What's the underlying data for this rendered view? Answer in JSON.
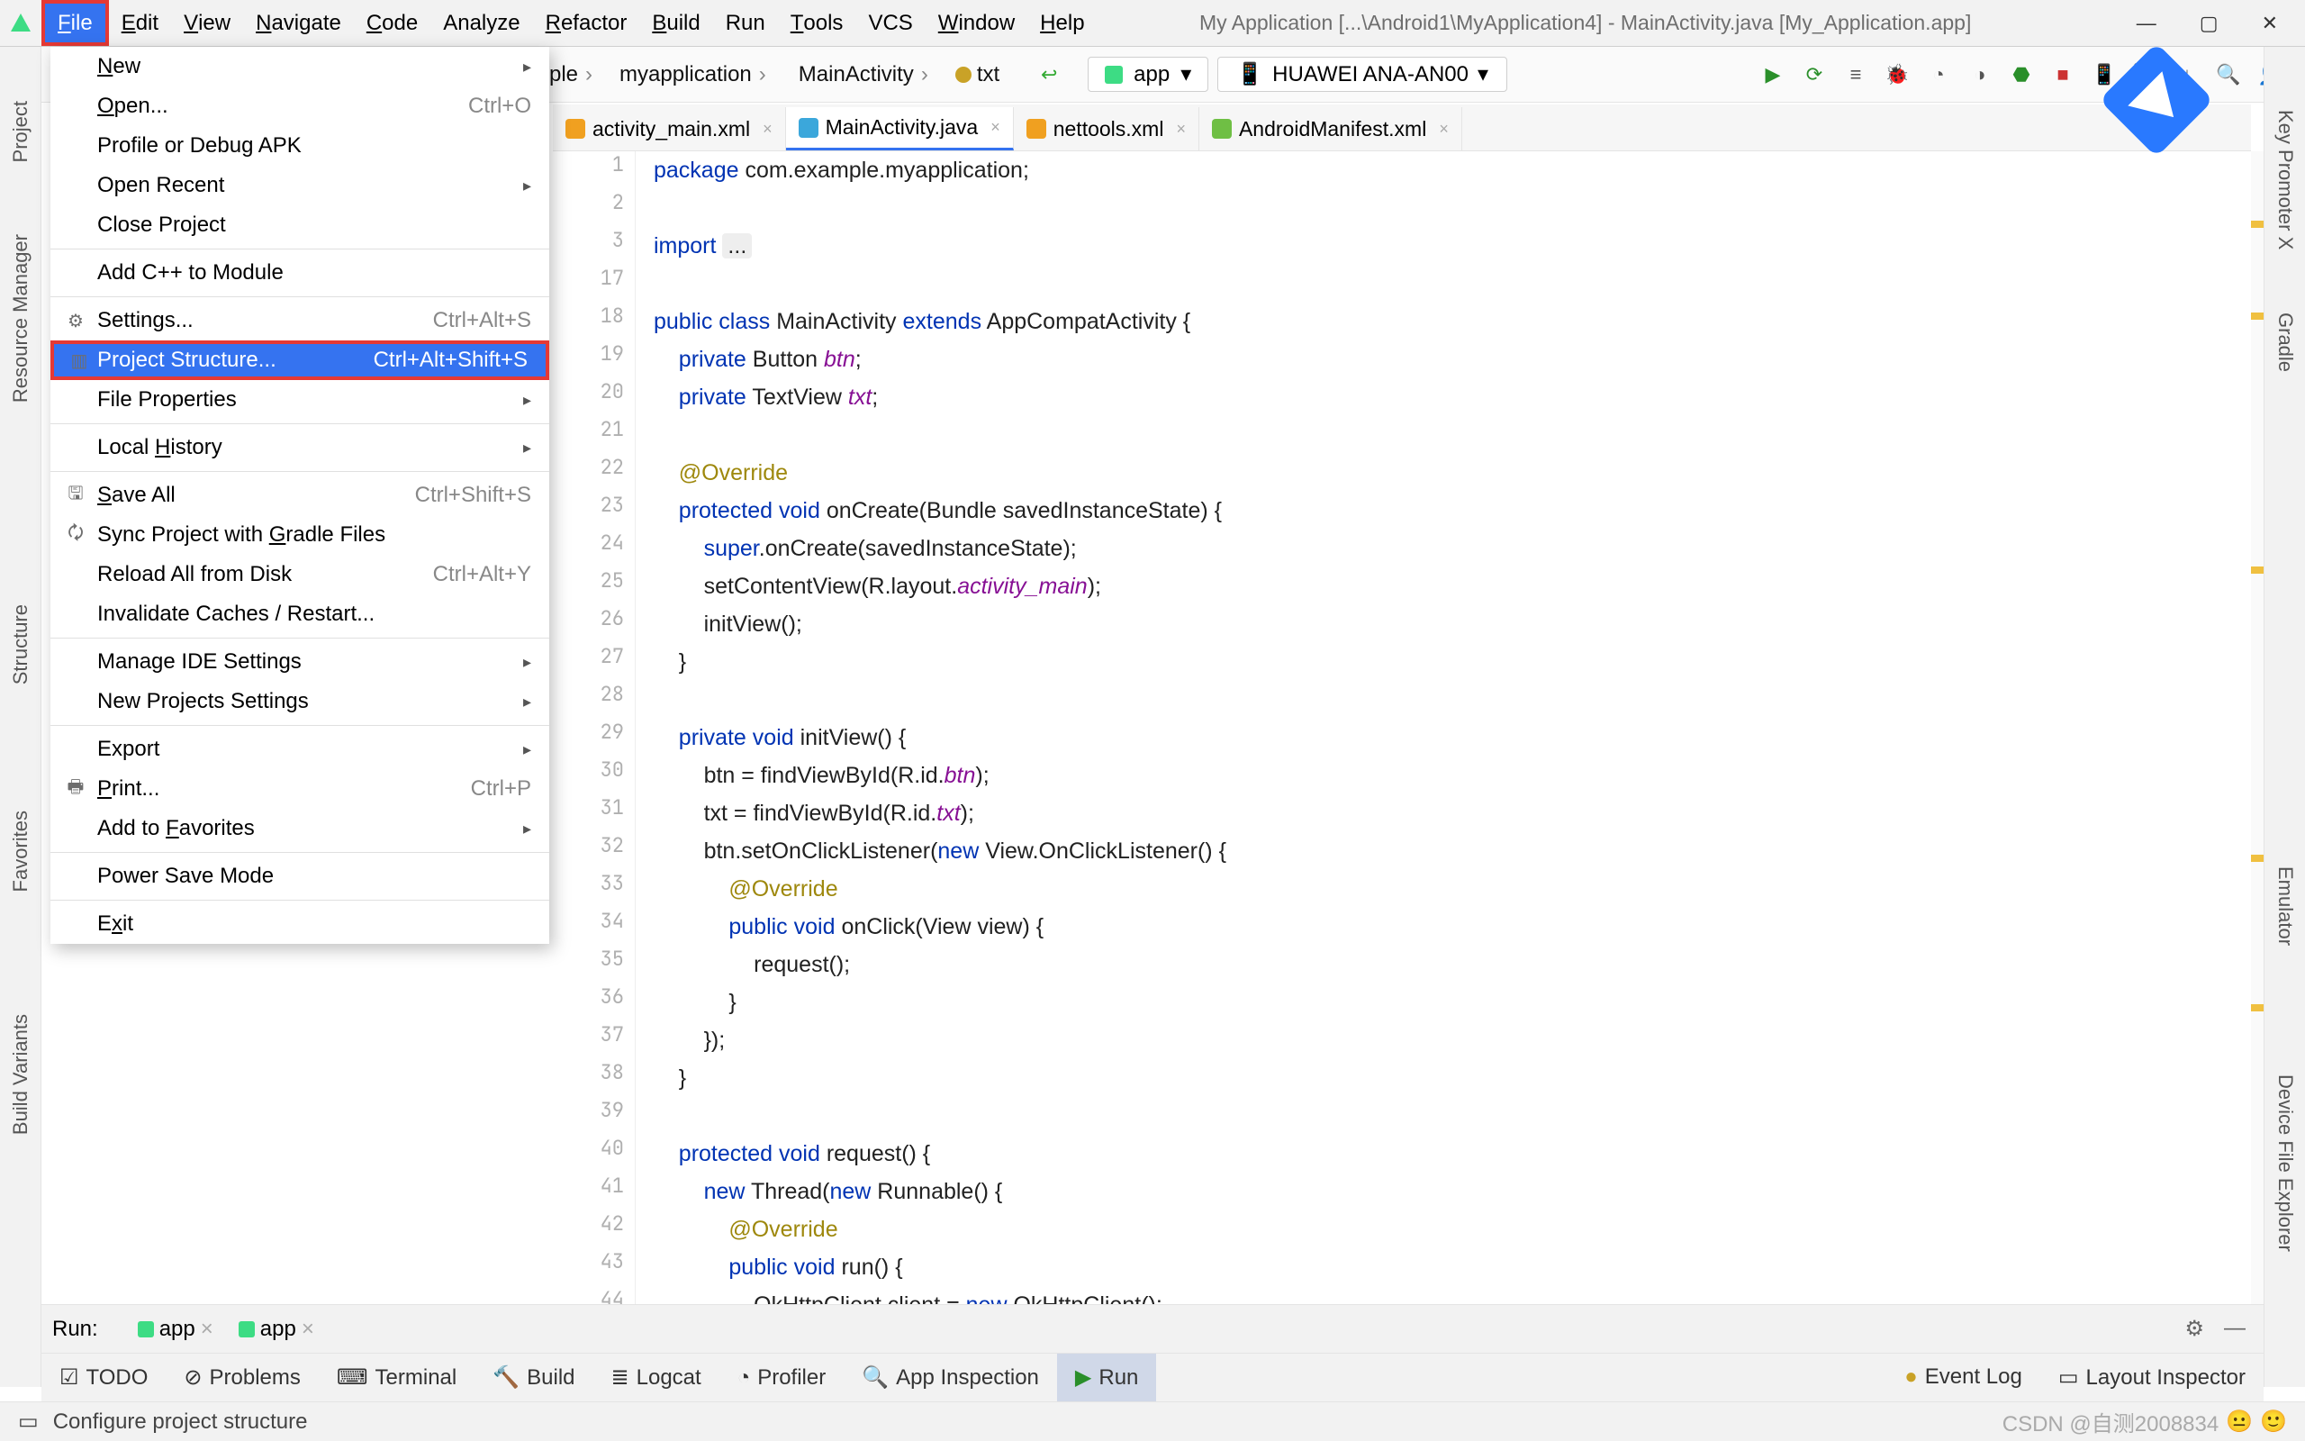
{
  "menubar": {
    "items": [
      {
        "label": "File",
        "u": "F"
      },
      {
        "label": "Edit",
        "u": "E"
      },
      {
        "label": "View",
        "u": "V"
      },
      {
        "label": "Navigate",
        "u": "N"
      },
      {
        "label": "Code",
        "u": "C"
      },
      {
        "label": "Analyze",
        "u": ""
      },
      {
        "label": "Refactor",
        "u": "R"
      },
      {
        "label": "Build",
        "u": "B"
      },
      {
        "label": "Run",
        "u": ""
      },
      {
        "label": "Tools",
        "u": "T"
      },
      {
        "label": "VCS",
        "u": ""
      },
      {
        "label": "Window",
        "u": "W"
      },
      {
        "label": "Help",
        "u": "H"
      }
    ],
    "title": "My Application [...\\Android1\\MyApplication4] - MainActivity.java [My_Application.app]"
  },
  "breadcrumb": {
    "i0": "ple",
    "i1": "myapplication",
    "i2": "MainActivity",
    "i3": "txt"
  },
  "combo": {
    "app": "app",
    "device": "HUAWEI ANA-AN00",
    "device_arrow": "▾"
  },
  "tabs": [
    {
      "name": "activity_main.xml",
      "type": "xml"
    },
    {
      "name": "MainActivity.java",
      "type": "java"
    },
    {
      "name": "nettools.xml",
      "type": "xml"
    },
    {
      "name": "AndroidManifest.xml",
      "type": "mf"
    }
  ],
  "filemenu": [
    {
      "label": "New",
      "u": "N",
      "arrow": true
    },
    {
      "label": "Open...",
      "u": "O",
      "sc": "Ctrl+O"
    },
    {
      "label": "Profile or Debug APK"
    },
    {
      "label": "Open Recent",
      "arrow": true,
      "u": ""
    },
    {
      "label": "Close Project"
    },
    {
      "sep": true
    },
    {
      "label": "Add C++ to Module"
    },
    {
      "sep": true
    },
    {
      "label": "Settings...",
      "u": "",
      "sc": "Ctrl+Alt+S",
      "icon": "⚙"
    },
    {
      "label": "Project Structure...",
      "u": "",
      "sc": "Ctrl+Alt+Shift+S",
      "hl": true,
      "icon": "▥"
    },
    {
      "label": "File Properties",
      "arrow": true
    },
    {
      "sep": true
    },
    {
      "label": "Local History",
      "u": "H",
      "arrow": true
    },
    {
      "sep": true
    },
    {
      "label": "Save All",
      "u": "S",
      "sc": "Ctrl+Shift+S",
      "icon": "🖫"
    },
    {
      "label": "Sync Project with Gradle Files",
      "u": "G",
      "icon": "🗘"
    },
    {
      "label": "Reload All from Disk",
      "u": "",
      "sc": "Ctrl+Alt+Y"
    },
    {
      "label": "Invalidate Caches / Restart..."
    },
    {
      "sep": true
    },
    {
      "label": "Manage IDE Settings",
      "arrow": true
    },
    {
      "label": "New Projects Settings",
      "arrow": true
    },
    {
      "sep": true
    },
    {
      "label": "Export",
      "arrow": true
    },
    {
      "label": "Print...",
      "u": "P",
      "sc": "Ctrl+P",
      "icon": "🖶"
    },
    {
      "label": "Add to Favorites",
      "u": "F",
      "arrow": true
    },
    {
      "sep": true
    },
    {
      "label": "Power Save Mode"
    },
    {
      "sep": true
    },
    {
      "label": "Exit",
      "u": "x"
    }
  ],
  "warnings": {
    "count": "8"
  },
  "gutter_start": 1,
  "code_lines": [
    {
      "n": "1",
      "t": "package com.example.myapplication;",
      "cls": [
        "kw0"
      ]
    },
    {
      "n": "2",
      "t": ""
    },
    {
      "n": "3",
      "t": "import ..."
    },
    {
      "n": "17",
      "t": ""
    },
    {
      "n": "18",
      "t": "public class MainActivity extends AppCompatActivity {"
    },
    {
      "n": "19",
      "t": "    private Button btn;"
    },
    {
      "n": "20",
      "t": "    private TextView txt;"
    },
    {
      "n": "21",
      "t": ""
    },
    {
      "n": "22",
      "t": "    @Override"
    },
    {
      "n": "23",
      "t": "    protected void onCreate(Bundle savedInstanceState) {"
    },
    {
      "n": "24",
      "t": "        super.onCreate(savedInstanceState);"
    },
    {
      "n": "25",
      "t": "        setContentView(R.layout.activity_main);"
    },
    {
      "n": "26",
      "t": "        initView();"
    },
    {
      "n": "27",
      "t": "    }"
    },
    {
      "n": "28",
      "t": ""
    },
    {
      "n": "29",
      "t": "    private void initView() {"
    },
    {
      "n": "30",
      "t": "        btn = findViewById(R.id.btn);"
    },
    {
      "n": "31",
      "t": "        txt = findViewById(R.id.txt);"
    },
    {
      "n": "32",
      "t": "        btn.setOnClickListener(new View.OnClickListener() {"
    },
    {
      "n": "33",
      "t": "            @Override"
    },
    {
      "n": "34",
      "t": "            public void onClick(View view) {"
    },
    {
      "n": "35",
      "t": "                request();"
    },
    {
      "n": "36",
      "t": "            }"
    },
    {
      "n": "37",
      "t": "        });"
    },
    {
      "n": "38",
      "t": "    }"
    },
    {
      "n": "39",
      "t": ""
    },
    {
      "n": "40",
      "t": "    protected void request() {"
    },
    {
      "n": "41",
      "t": "        new Thread(new Runnable() {"
    },
    {
      "n": "42",
      "t": "            @Override"
    },
    {
      "n": "43",
      "t": "            public void run() {"
    },
    {
      "n": "44",
      "t": "                OkHttpClient client = new OkHttpClient();"
    }
  ],
  "left_tools": {
    "project": "Project",
    "res": "Resource Manager",
    "struct": "Structure",
    "fav": "Favorites",
    "bv": "Build Variants"
  },
  "right_tools": {
    "kp": "Key Promoter X",
    "gr": "Gradle",
    "em": "Emulator",
    "de": "Device File Explorer"
  },
  "run": {
    "label": "Run:",
    "t1": "app",
    "t2": "app"
  },
  "bottom": {
    "todo": "TODO",
    "problems": "Problems",
    "terminal": "Terminal",
    "build": "Build",
    "logcat": "Logcat",
    "profiler": "Profiler",
    "appinsp": "App Inspection",
    "run": "Run",
    "evlog": "Event Log",
    "layout": "Layout Inspector"
  },
  "status": {
    "msg": "Configure project structure",
    "right": "CSDN @自测2008834"
  }
}
